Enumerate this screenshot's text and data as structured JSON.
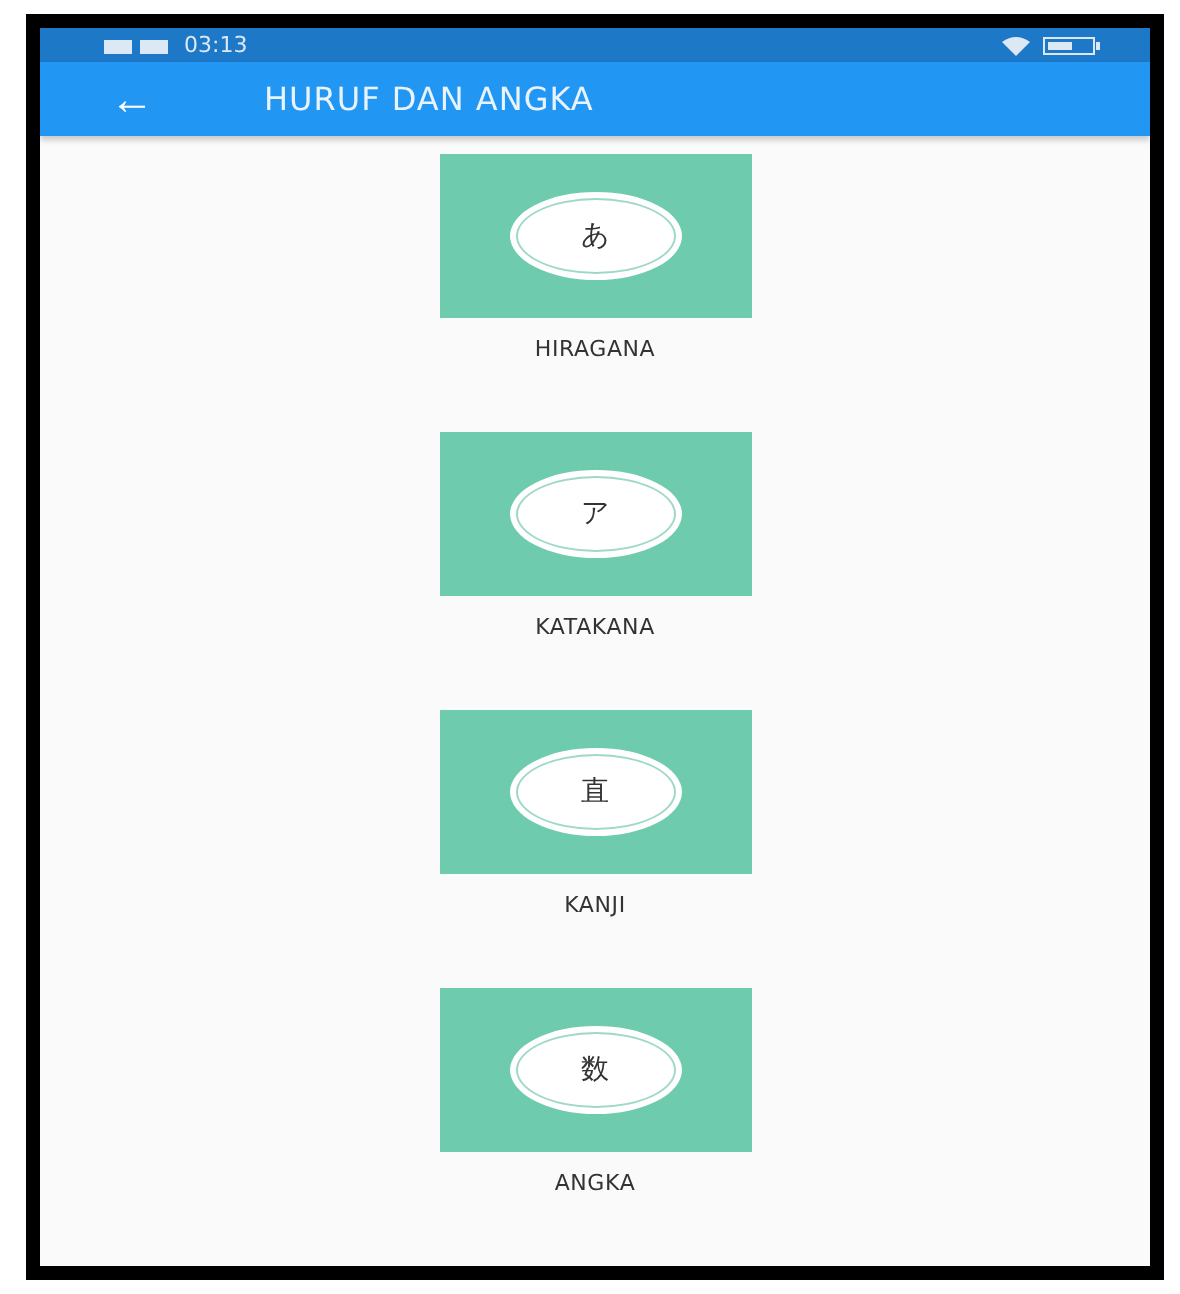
{
  "status_bar": {
    "time": "03:13"
  },
  "app_bar": {
    "back": "←",
    "title": "HURUF DAN ANGKA"
  },
  "items": [
    {
      "glyph": "あ",
      "label": "HIRAGANA"
    },
    {
      "glyph": "ア",
      "label": "KATAKANA"
    },
    {
      "glyph": "直",
      "label": "KANJI"
    },
    {
      "glyph": "数",
      "label": "ANGKA"
    }
  ]
}
